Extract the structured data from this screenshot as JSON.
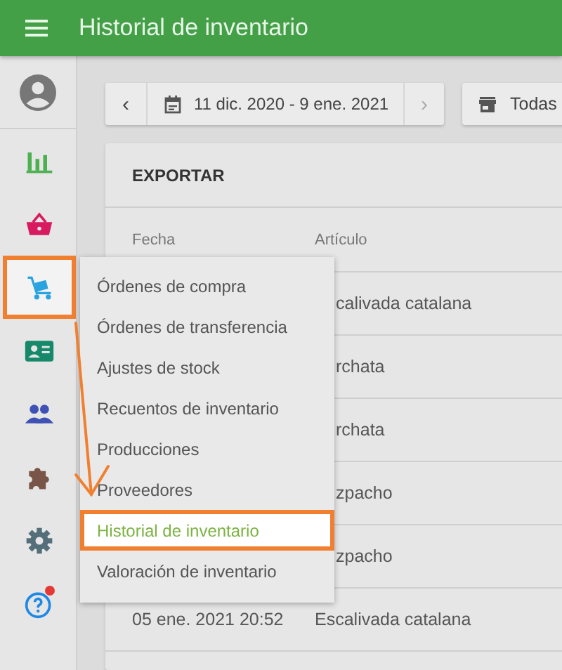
{
  "app_bar": {
    "title": "Historial de inventario"
  },
  "sidebar": {
    "items": [
      {
        "selected": false,
        "highlighted": false,
        "notification": false
      },
      {
        "selected": false,
        "highlighted": false,
        "notification": false
      },
      {
        "selected": true,
        "highlighted": true,
        "notification": false
      },
      {
        "selected": false,
        "highlighted": false,
        "notification": false
      },
      {
        "selected": false,
        "highlighted": false,
        "notification": false
      },
      {
        "selected": false,
        "highlighted": false,
        "notification": false
      },
      {
        "selected": false,
        "highlighted": false,
        "notification": false
      },
      {
        "selected": false,
        "highlighted": false,
        "notification": true
      }
    ]
  },
  "toolbar": {
    "prev": "‹",
    "date_range": "11 dic. 2020 - 9 ene. 2021",
    "next": "›",
    "store_filter": "Todas"
  },
  "card": {
    "title": "EXPORTAR",
    "columns": [
      "Fecha",
      "Artículo"
    ],
    "rows": [
      {
        "covered": true,
        "cells": [
          "",
          "calivada catalana"
        ]
      },
      {
        "covered": true,
        "cells": [
          "",
          "rchata"
        ]
      },
      {
        "covered": true,
        "cells": [
          "",
          "rchata"
        ]
      },
      {
        "covered": true,
        "cells": [
          "",
          "zpacho"
        ]
      },
      {
        "covered": true,
        "cells": [
          "",
          "zpacho"
        ]
      },
      {
        "covered": false,
        "cells": [
          "05 ene. 2021 20:52",
          "Escalivada catalana"
        ]
      }
    ]
  },
  "menu": {
    "items": [
      {
        "label": "Órdenes de compra",
        "selected": false,
        "highlighted": false
      },
      {
        "label": "Órdenes de transferencia",
        "selected": false,
        "highlighted": false
      },
      {
        "label": "Ajustes de stock",
        "selected": false,
        "highlighted": false
      },
      {
        "label": "Recuentos de inventario",
        "selected": false,
        "highlighted": false
      },
      {
        "label": "Producciones",
        "selected": false,
        "highlighted": false
      },
      {
        "label": "Proveedores",
        "selected": false,
        "highlighted": false
      },
      {
        "label": "Historial de inventario",
        "selected": true,
        "highlighted": true
      },
      {
        "label": "Valoración de inventario",
        "selected": false,
        "highlighted": false
      }
    ]
  }
}
